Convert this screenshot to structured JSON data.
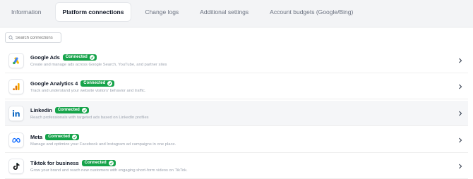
{
  "tabs": [
    {
      "label": "Information"
    },
    {
      "label": "Platform connections"
    },
    {
      "label": "Change logs"
    },
    {
      "label": "Additional settings"
    },
    {
      "label": "Account budgets (Google/Bing)"
    }
  ],
  "search": {
    "placeholder": "Search connections"
  },
  "status_label": "Connected",
  "colors": {
    "connected": "#16a34a",
    "accent_blue": "#1a73e8"
  },
  "connections": [
    {
      "name": "Google Ads",
      "status": "Connected",
      "description": "Create and manage ads across Google Search, YouTube, and partner sites",
      "icon": "google-ads-icon"
    },
    {
      "name": "Google Analytics 4",
      "status": "Connected",
      "description": "Track and understand your website visitors' behavior and traffic.",
      "icon": "google-analytics-icon"
    },
    {
      "name": "Linkedin",
      "status": "Connected",
      "description": "Reach professionals with targeted ads based on LinkedIn profiles",
      "icon": "linkedin-icon"
    },
    {
      "name": "Meta",
      "status": "Connected",
      "description": "Manage and optimize your Facebook and Instagram ad campaigns in one place.",
      "icon": "meta-icon"
    },
    {
      "name": "Tiktok for business",
      "status": "Connected",
      "description": "Grow your brand and reach new customers with engaging short-form videos on TikTok.",
      "icon": "tiktok-icon"
    }
  ]
}
